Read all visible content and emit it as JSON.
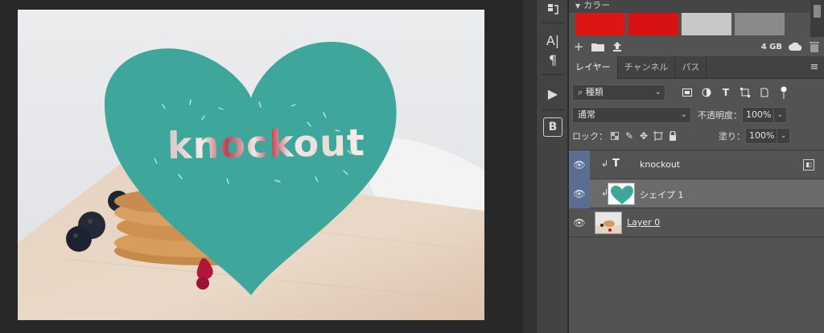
{
  "canvas": {
    "text_layer_content": "knockout"
  },
  "icon_strip": {
    "items": [
      "history-icon",
      "character-icon",
      "paragraph-icon",
      "actions-play-icon",
      "brush-b-icon"
    ],
    "character_glyph": "A|",
    "paragraph_glyph": "¶",
    "play_glyph": "▶",
    "b_glyph": "B"
  },
  "swatches": {
    "header": "カラー",
    "colors": [
      "#dc1515",
      "#d81212",
      "#c8c8c8",
      "#8a8a8a"
    ]
  },
  "library": {
    "storage": "4 GB"
  },
  "tabs": {
    "items": [
      "レイヤー",
      "チャンネル",
      "パス"
    ],
    "active": "レイヤー"
  },
  "layer_controls": {
    "filter_label": "種類",
    "blend_mode": "通常",
    "opacity_label": "不透明度：",
    "opacity_value": "100%",
    "lock_label": "ロック：",
    "fill_label": "塗り：",
    "fill_value": "100%"
  },
  "layers": [
    {
      "name": "knockout",
      "type": "text",
      "type_glyph": "T",
      "clipped": true,
      "selected": false
    },
    {
      "name": "シェイプ 1",
      "type": "shape",
      "clipped": true,
      "selected": true
    },
    {
      "name": "Layer 0",
      "type": "pixel",
      "clipped": false,
      "selected": false
    }
  ],
  "colors": {
    "heart": "#3ea69b",
    "panel_bg": "#535353",
    "selected_layer": "#6b6b6b",
    "eye_blue": "#5a6e91"
  }
}
